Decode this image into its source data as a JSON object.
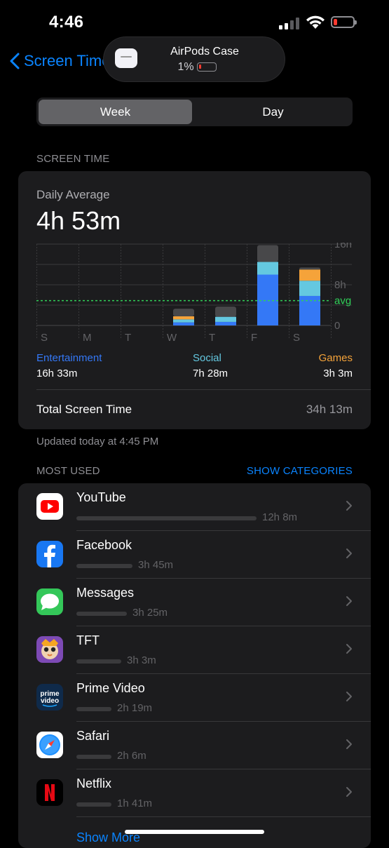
{
  "status_bar": {
    "time": "4:46"
  },
  "nav": {
    "back_label": "Screen Time"
  },
  "popup": {
    "title": "AirPods Case",
    "battery": "1%"
  },
  "segments": {
    "week": "Week",
    "day": "Day",
    "selected": "Week"
  },
  "screen_time": {
    "section_label": "SCREEN TIME",
    "daily_label": "Daily Average",
    "daily_value": "4h 53m",
    "total_label": "Total Screen Time",
    "total_value": "34h 13m",
    "updated": "Updated today at 4:45 PM"
  },
  "categories": [
    {
      "name": "Entertainment",
      "value": "16h 33m",
      "color": "#3478f6"
    },
    {
      "name": "Social",
      "value": "7h 28m",
      "color": "#64c8e0"
    },
    {
      "name": "Games",
      "value": "3h 3m",
      "color": "#f5a33a"
    }
  ],
  "chart_data": {
    "type": "bar",
    "stacked": true,
    "categories": [
      "S",
      "M",
      "T",
      "W",
      "T",
      "F",
      "S"
    ],
    "series": [
      {
        "name": "Entertainment",
        "color": "#3478f6",
        "values": [
          0,
          0,
          0,
          0.6,
          0.7,
          10,
          5.8
        ]
      },
      {
        "name": "Social",
        "color": "#64c8e0",
        "values": [
          0,
          0,
          0,
          0.6,
          1.0,
          2.5,
          3.0
        ]
      },
      {
        "name": "Games",
        "color": "#f5a33a",
        "values": [
          0,
          0,
          0,
          0.6,
          0,
          0,
          2.2
        ]
      },
      {
        "color": "#48484a",
        "values": [
          0,
          0,
          0,
          1.5,
          2.0,
          3.3,
          0.4
        ]
      }
    ],
    "y_ticks": [
      "16h",
      "8h",
      "0"
    ],
    "avg_label": "avg",
    "avg_value": 4.88,
    "ylim": [
      0,
      16
    ]
  },
  "most_used": {
    "section_label": "MOST USED",
    "show_categories": "SHOW CATEGORIES",
    "show_more": "Show More",
    "apps": [
      {
        "name": "YouTube",
        "duration": "12h 8m",
        "fraction": 1.0,
        "icon": "youtube-icon"
      },
      {
        "name": "Facebook",
        "duration": "3h 45m",
        "fraction": 0.31,
        "icon": "facebook-icon"
      },
      {
        "name": "Messages",
        "duration": "3h 25m",
        "fraction": 0.28,
        "icon": "messages-icon"
      },
      {
        "name": "TFT",
        "duration": "3h 3m",
        "fraction": 0.25,
        "icon": "tft-icon"
      },
      {
        "name": "Prime Video",
        "duration": "2h 19m",
        "fraction": 0.19,
        "icon": "prime-video-icon"
      },
      {
        "name": "Safari",
        "duration": "2h 6m",
        "fraction": 0.17,
        "icon": "safari-icon"
      },
      {
        "name": "Netflix",
        "duration": "1h 41m",
        "fraction": 0.14,
        "icon": "netflix-icon"
      }
    ]
  }
}
